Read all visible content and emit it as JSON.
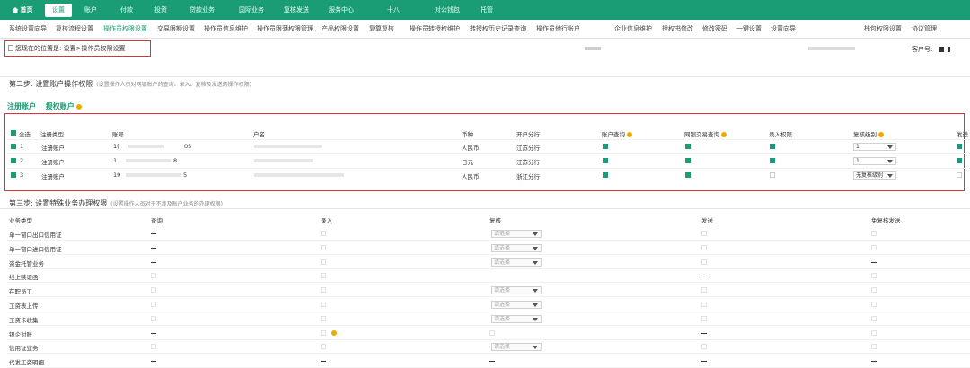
{
  "topnav": {
    "home": "首页",
    "items": [
      "设置",
      "账户",
      "付款",
      "投资",
      "贷款业务",
      "国际业务",
      "复核发送",
      "服务中心",
      "十八",
      "对公钱包",
      "托管"
    ],
    "active_index": 0
  },
  "subnav": {
    "items": [
      "系统设置向导",
      "复核流程设置",
      "操作员权限设置",
      "交易限额设置",
      "操作员信息维护",
      "操作员限薄权限管理",
      "产品权限设置",
      "复算复核",
      "操作员转授权维护",
      "转授权历史记录查询",
      "操作员他行账户",
      "",
      "企业信息维护",
      "授权书修改",
      "修改密码",
      "一键设置",
      "设置向导",
      "",
      "栈包权限设置",
      "协议管理"
    ],
    "active_index": 2
  },
  "breadcrumb": "您现在的位置是: 设置>操作员权限设置",
  "customer_label": "客户号: ",
  "step2": {
    "title": "第二步: 设置账户操作权限",
    "note": "(设置操作人员对网银账户的查询、录入、复核及发送的操作权限)"
  },
  "tabs": {
    "registered": "注册账户",
    "authorized": "授权账户"
  },
  "account_table": {
    "headers": [
      "全选",
      "注册类型",
      "账号",
      "户名",
      "币种",
      "开户分行",
      "账户查询",
      "网银交易查询",
      "录入权限",
      "复核级别",
      "发送"
    ],
    "rows": [
      {
        "no": "1",
        "type": "注册账户",
        "acct": "1(",
        "acct_tail": "05",
        "currency": "人民币",
        "branch": "江苏分行",
        "query": true,
        "ebank": true,
        "entry": true,
        "level": "1",
        "send": true
      },
      {
        "no": "2",
        "type": "注册账户",
        "acct": "1.",
        "acct_tail": "8",
        "currency": "日元",
        "branch": "江苏分行",
        "query": true,
        "ebank": true,
        "entry": true,
        "level": "1",
        "send": true
      },
      {
        "no": "3",
        "type": "注册账户",
        "acct": "19",
        "acct_tail": "5",
        "currency": "人民币",
        "branch": "浙江分行",
        "query": true,
        "ebank": true,
        "entry": false,
        "level": "无复核级别",
        "send": false
      }
    ]
  },
  "step3": {
    "title": "第三步: 设置特殊业务办理权限",
    "note": "(设置操作人员对于不涉及账户业务的办理权限)"
  },
  "biz_table": {
    "headers": [
      "业务类型",
      "查询",
      "录入",
      "复核",
      "发送",
      "免复核发送"
    ],
    "select_placeholder": "请选择",
    "rows": [
      {
        "name": "单一窗口出口信用证",
        "query": "dash",
        "entry": "box",
        "review": "select",
        "send": "box",
        "free": "box"
      },
      {
        "name": "单一窗口进口信用证",
        "query": "dash",
        "entry": "box",
        "review": "select",
        "send": "box",
        "free": "box"
      },
      {
        "name": "资金托管业务",
        "query": "dash",
        "entry": "box",
        "review": "select",
        "send": "box",
        "free": "dash"
      },
      {
        "name": "线上赎证函",
        "query": "box",
        "entry": "box",
        "review": "none",
        "send": "dash",
        "free": "box"
      },
      {
        "name": "在职员工",
        "query": "box",
        "entry": "box",
        "review": "select",
        "send": "box",
        "free": "box"
      },
      {
        "name": "工资表上传",
        "query": "box",
        "entry": "box",
        "review": "select",
        "send": "box",
        "free": "box"
      },
      {
        "name": "工资卡收集",
        "query": "box",
        "entry": "box",
        "review": "select",
        "send": "box",
        "free": "box"
      },
      {
        "name": "银企对账",
        "query": "dash",
        "entry": "boxq",
        "review": "box",
        "send": "dash",
        "free": "box"
      },
      {
        "name": "信用证业务",
        "query": "box",
        "entry": "box",
        "review": "select",
        "send": "box",
        "free": "box"
      },
      {
        "name": "代发工资明细",
        "query": "dash",
        "entry": "dash",
        "review": "dash",
        "send": "dash",
        "free": "dash"
      }
    ]
  },
  "colors": {
    "primary": "#1a9d75",
    "highlight": "#e0303a",
    "help": "#f0a800"
  }
}
